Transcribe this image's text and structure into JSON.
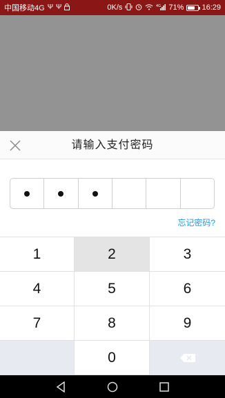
{
  "status_bar": {
    "carrier": "中国移动4G",
    "net_speed": "0K/s",
    "signal": "4G",
    "battery": "71%",
    "battery_level": 0.71,
    "time": "16:29"
  },
  "dialog": {
    "title": "请输入支付密码",
    "close_icon": "close-icon",
    "pin_length": 6,
    "pin_filled": 3,
    "forgot_label": "忘记密码?"
  },
  "keypad": {
    "keys": [
      "1",
      "2",
      "3",
      "4",
      "5",
      "6",
      "7",
      "8",
      "9",
      "",
      "0",
      "delete"
    ],
    "pressed_key": "2"
  },
  "colors": {
    "status_bar": "#8b1616",
    "link": "#1c9be6",
    "overlay": "#939393",
    "key_side": "#e7eaf0",
    "key_pressed": "#e4e4e4"
  },
  "nav": [
    "back-icon",
    "home-icon",
    "recents-icon"
  ]
}
